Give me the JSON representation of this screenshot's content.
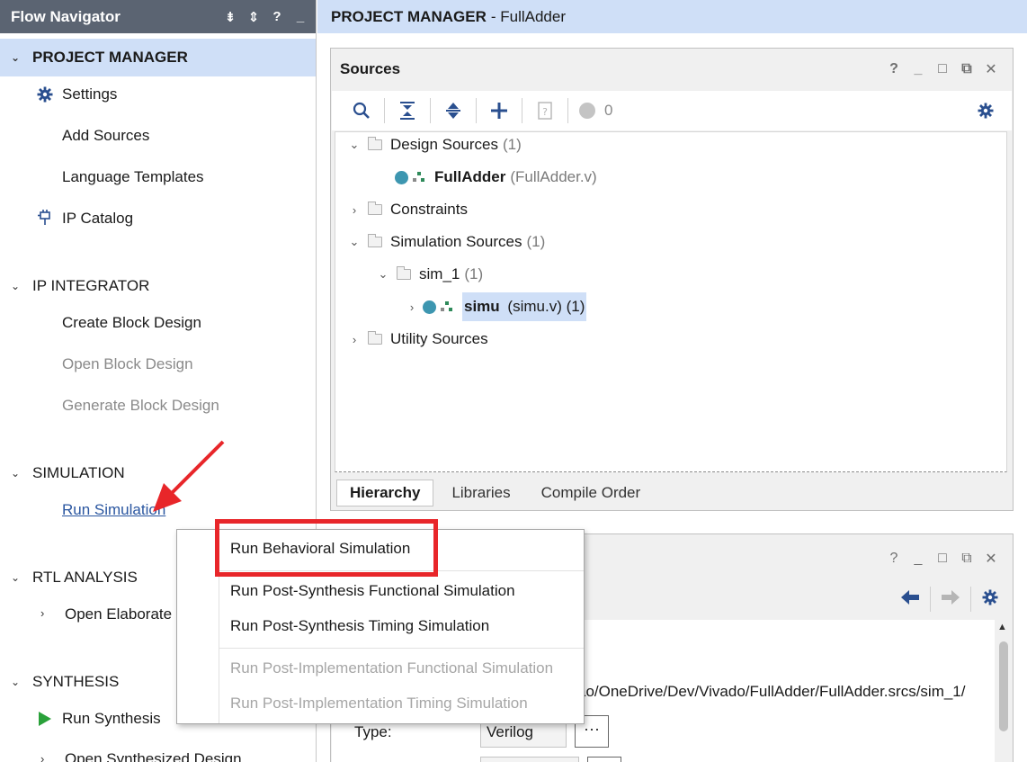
{
  "flow_navigator": {
    "title": "Flow Navigator",
    "header_icons": [
      "collapse-all-icon",
      "expand-all-icon",
      "help-icon",
      "minimize-icon"
    ],
    "sections": [
      {
        "label": "PROJECT MANAGER",
        "active": true,
        "items": [
          {
            "label": "Settings",
            "icon": "gear-icon"
          },
          {
            "label": "Add Sources"
          },
          {
            "label": "Language Templates"
          },
          {
            "label": "IP Catalog",
            "icon": "plug-icon"
          }
        ]
      },
      {
        "label": "IP INTEGRATOR",
        "items": [
          {
            "label": "Create Block Design"
          },
          {
            "label": "Open Block Design",
            "disabled": true
          },
          {
            "label": "Generate Block Design",
            "disabled": true
          }
        ]
      },
      {
        "label": "SIMULATION",
        "items": [
          {
            "label": "Run Simulation",
            "link": true
          }
        ]
      },
      {
        "label": "RTL ANALYSIS",
        "items": [
          {
            "label": "Open Elaborate",
            "expandable": true
          }
        ]
      },
      {
        "label": "SYNTHESIS",
        "items": [
          {
            "label": "Run Synthesis",
            "icon": "play-icon"
          },
          {
            "label": "Open Synthesized Design",
            "expandable": true
          }
        ]
      }
    ]
  },
  "title_bar": {
    "bold": "PROJECT MANAGER",
    "rest": "- FullAdder"
  },
  "sources": {
    "title": "Sources",
    "win_controls": [
      "?",
      "_",
      "□",
      "⧉",
      "✕"
    ],
    "toolbar": {
      "warning_count": "0"
    },
    "tree": [
      {
        "label": "Design Sources",
        "count": "(1)",
        "expanded": true
      },
      {
        "name": "FullAdder",
        "file": "(FullAdder.v)"
      },
      {
        "label": "Constraints",
        "expanded": false
      },
      {
        "label": "Simulation Sources",
        "count": "(1)",
        "expanded": true
      },
      {
        "label": "sim_1",
        "count": "(1)",
        "expanded": true
      },
      {
        "name": "simu",
        "file": "(simu.v) (1)"
      },
      {
        "label": "Utility Sources",
        "expanded": false
      }
    ],
    "tabs": [
      "Hierarchy",
      "Libraries",
      "Compile Order"
    ]
  },
  "properties": {
    "path_fragment": "ao/OneDrive/Dev/Vivado/FullAdder/FullAdder.srcs/sim_1/",
    "type_label": "Type:",
    "type_value": "Verilog",
    "more_button": "···"
  },
  "context_menu": {
    "items": [
      {
        "label": "Run Behavioral Simulation",
        "highlighted": true
      },
      {
        "label": "Run Post-Synthesis Functional Simulation"
      },
      {
        "label": "Run Post-Synthesis Timing Simulation"
      },
      {
        "label": "Run Post-Implementation Functional Simulation",
        "disabled": true
      },
      {
        "label": "Run Post-Implementation Timing Simulation",
        "disabled": true
      }
    ]
  },
  "colors": {
    "nav_header": "#5b6472",
    "selection": "#cfdff7",
    "annotation_red": "#e8262a",
    "icon_blue": "#2a4f8f",
    "play_green": "#2aa13a"
  }
}
